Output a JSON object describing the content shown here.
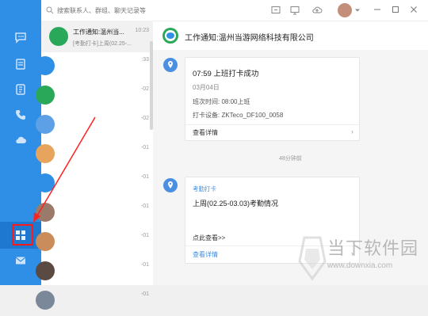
{
  "search": {
    "placeholder": "搜索联系人、群组、聊天记录等"
  },
  "nav": {
    "items": [
      {
        "name": "messages-icon"
      },
      {
        "name": "workbench-icon"
      },
      {
        "name": "contacts-icon"
      },
      {
        "name": "phone-icon"
      },
      {
        "name": "cloud-icon"
      },
      {
        "name": "apps-grid-icon"
      },
      {
        "name": "mail-icon"
      }
    ],
    "accent": "#2f8fe6",
    "highlight": "#ff1a1a"
  },
  "conversations": [
    {
      "title": "工作通知:温州当...",
      "subtitle": "[考勤打卡]上周(02.25-...",
      "time": "10:23",
      "color": "#2aa85a"
    },
    {
      "title": "",
      "subtitle": "",
      "time": ":33",
      "color": "#2f8fe6"
    },
    {
      "title": "",
      "subtitle": "",
      "time": "-02",
      "color": "#2aa85a"
    },
    {
      "title": "",
      "subtitle": "",
      "time": "-02",
      "color": "#5da0e6"
    },
    {
      "title": "",
      "subtitle": "",
      "time": "-01",
      "color": "#e6a45d"
    },
    {
      "title": "",
      "subtitle": "",
      "time": "-01",
      "color": "#2f8fe6"
    },
    {
      "title": "",
      "subtitle": "",
      "time": "-01",
      "color": "#9a7b6a"
    },
    {
      "title": "",
      "subtitle": "",
      "time": "-01",
      "color": "#c98c5a"
    },
    {
      "title": "",
      "subtitle": "",
      "time": "-01",
      "color": "#5a4a42"
    },
    {
      "title": "",
      "subtitle": "",
      "time": "-01",
      "color": "#7a8899"
    }
  ],
  "chat": {
    "title": "工作通知:温州当游网络科技有限公司",
    "card1": {
      "heading": "07:59 上班打卡成功",
      "date": "03月04日",
      "shift": "班次时间: 08:00上班",
      "device": "打卡设备: ZKTeco_DF100_0058",
      "detail": "查看详情"
    },
    "time_sep": "48分钟前",
    "card2": {
      "tag": "考勤打卡",
      "heading": "上周(02.25-03.03)考勤情况",
      "cta": "点此查看>>",
      "detail": "查看详情"
    }
  },
  "watermark": {
    "brand": "当下软件园",
    "url": "www.downxia.com"
  }
}
